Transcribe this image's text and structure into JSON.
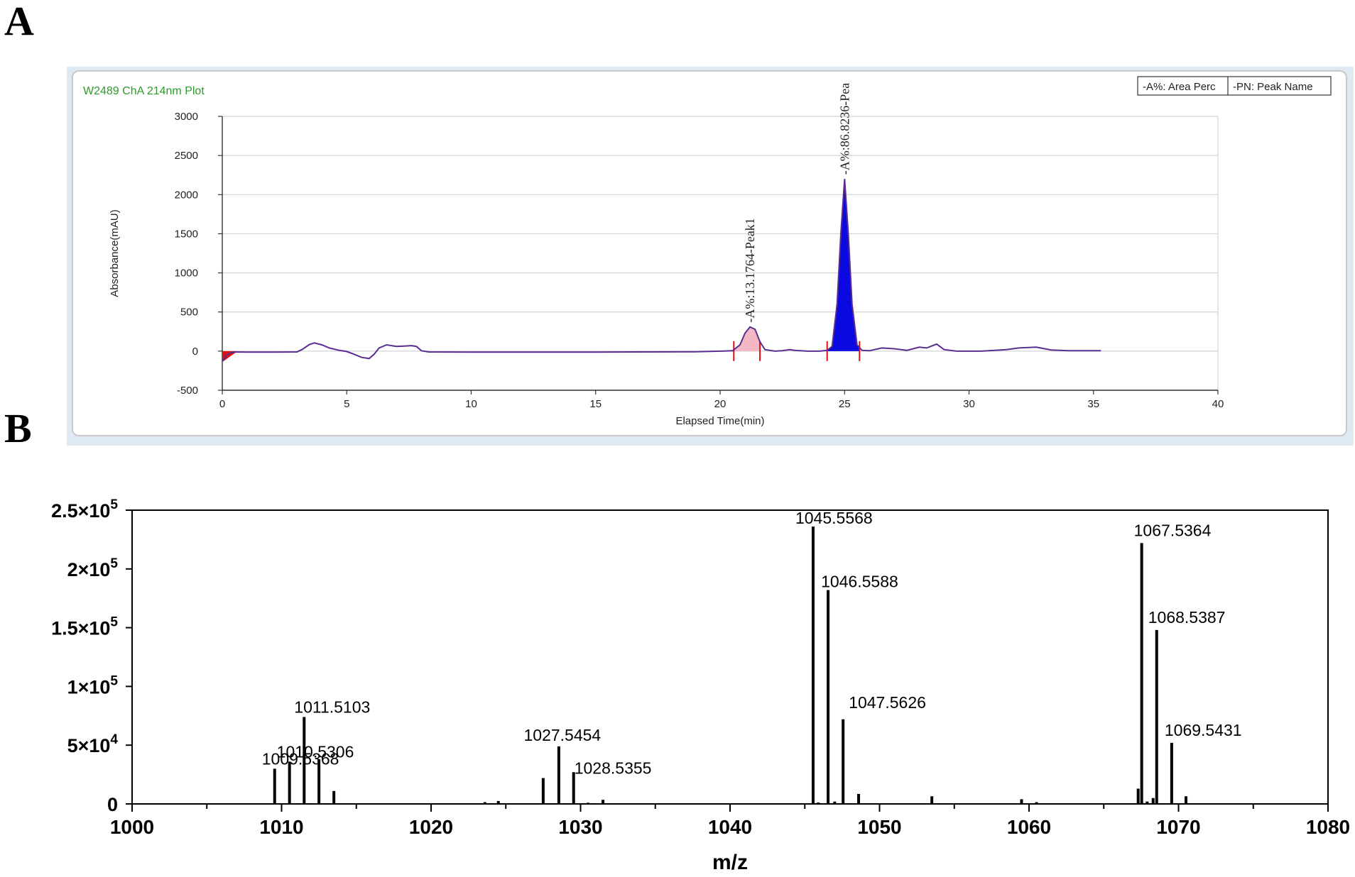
{
  "panels": {
    "a_letter": "A",
    "b_letter": "B"
  },
  "chart_data": [
    {
      "type": "line",
      "panel": "A",
      "title": "W2489 ChA 214nm Plot",
      "xlabel": "Elapsed Time(min)",
      "ylabel": "Absorbance(mAU)",
      "xlim": [
        0,
        40
      ],
      "ylim": [
        -500,
        3000
      ],
      "xticks": [
        0,
        5,
        10,
        15,
        20,
        25,
        30,
        35,
        40
      ],
      "yticks": [
        -500,
        0,
        500,
        1000,
        1500,
        2000,
        2500,
        3000
      ],
      "grid": true,
      "legend": {
        "position": "top-right",
        "entries": [
          "-A%: Area Perc",
          "-PN: Peak Name"
        ]
      },
      "trace": [
        [
          0.0,
          -130
        ],
        [
          0.15,
          -60
        ],
        [
          0.3,
          -25
        ],
        [
          0.5,
          -10
        ],
        [
          1.0,
          -12
        ],
        [
          2.0,
          -12
        ],
        [
          3.0,
          -10
        ],
        [
          3.2,
          20
        ],
        [
          3.5,
          85
        ],
        [
          3.7,
          105
        ],
        [
          4.0,
          80
        ],
        [
          4.3,
          40
        ],
        [
          4.7,
          10
        ],
        [
          5.0,
          -5
        ],
        [
          5.3,
          -40
        ],
        [
          5.6,
          -80
        ],
        [
          5.9,
          -95
        ],
        [
          6.1,
          -40
        ],
        [
          6.3,
          40
        ],
        [
          6.6,
          80
        ],
        [
          7.0,
          60
        ],
        [
          7.3,
          65
        ],
        [
          7.6,
          70
        ],
        [
          7.8,
          60
        ],
        [
          8.0,
          5
        ],
        [
          8.3,
          -10
        ],
        [
          10,
          -12
        ],
        [
          15,
          -12
        ],
        [
          19.0,
          -8
        ],
        [
          20.0,
          0
        ],
        [
          20.5,
          5
        ],
        [
          20.8,
          80
        ],
        [
          21.0,
          230
        ],
        [
          21.2,
          310
        ],
        [
          21.4,
          280
        ],
        [
          21.6,
          120
        ],
        [
          21.8,
          20
        ],
        [
          22.2,
          0
        ],
        [
          22.5,
          5
        ],
        [
          22.8,
          20
        ],
        [
          23.0,
          10
        ],
        [
          23.5,
          0
        ],
        [
          24.0,
          0
        ],
        [
          24.3,
          10
        ],
        [
          24.5,
          60
        ],
        [
          24.7,
          600
        ],
        [
          24.85,
          1500
        ],
        [
          25.0,
          2200
        ],
        [
          25.15,
          1500
        ],
        [
          25.3,
          600
        ],
        [
          25.5,
          80
        ],
        [
          25.7,
          10
        ],
        [
          26.0,
          5
        ],
        [
          26.5,
          40
        ],
        [
          27.0,
          30
        ],
        [
          27.5,
          10
        ],
        [
          28.0,
          50
        ],
        [
          28.3,
          40
        ],
        [
          28.7,
          90
        ],
        [
          29.0,
          20
        ],
        [
          29.5,
          0
        ],
        [
          30.5,
          0
        ],
        [
          31.5,
          20
        ],
        [
          32.0,
          40
        ],
        [
          32.7,
          50
        ],
        [
          33.3,
          15
        ],
        [
          34.0,
          5
        ],
        [
          35.3,
          5
        ]
      ],
      "peaks": [
        {
          "label": "-A%:13.1764-Peak1",
          "apex": [
            21.2,
            310
          ],
          "start": 20.55,
          "end": 21.6,
          "fill": "#f4b8c4"
        },
        {
          "label": "-A%:86.8236-Pea",
          "apex": [
            25.0,
            2200
          ],
          "start": 24.3,
          "end": 25.6,
          "fill": "#0a0ae0"
        }
      ],
      "line_color": "#5a2d91"
    },
    {
      "type": "bar",
      "panel": "B",
      "xlabel": "m/z",
      "ylabel": "",
      "xlim": [
        1000,
        1080
      ],
      "ylim": [
        0,
        250000
      ],
      "xticks": [
        1000,
        1010,
        1020,
        1030,
        1040,
        1050,
        1060,
        1070,
        1080
      ],
      "yticks": [
        {
          "value": 0,
          "mant": "0",
          "exp": ""
        },
        {
          "value": 50000,
          "mant": "5×10",
          "exp": "4"
        },
        {
          "value": 100000,
          "mant": "1×10",
          "exp": "5"
        },
        {
          "value": 150000,
          "mant": "1.5×10",
          "exp": "5"
        },
        {
          "value": 200000,
          "mant": "2×10",
          "exp": "5"
        },
        {
          "value": 250000,
          "mant": "2.5×10",
          "exp": "5"
        }
      ],
      "peaks": [
        {
          "mz": 1009.5368,
          "intensity": 30000,
          "label": "1009.5368"
        },
        {
          "mz": 1010.5306,
          "intensity": 36000,
          "label": "1010.5306"
        },
        {
          "mz": 1011.5103,
          "intensity": 74000,
          "label": "1011.5103"
        },
        {
          "mz": 1012.5,
          "intensity": 38000,
          "label": ""
        },
        {
          "mz": 1013.5,
          "intensity": 11000,
          "label": ""
        },
        {
          "mz": 1023.6,
          "intensity": 1500,
          "label": ""
        },
        {
          "mz": 1024.5,
          "intensity": 2500,
          "label": ""
        },
        {
          "mz": 1027.5,
          "intensity": 22000,
          "label": ""
        },
        {
          "mz": 1028.5454,
          "intensity": 49000,
          "label": "1027.5454"
        },
        {
          "mz": 1029.5355,
          "intensity": 27000,
          "label": "1028.5355"
        },
        {
          "mz": 1030.5,
          "intensity": 1000,
          "label": ""
        },
        {
          "mz": 1031.5,
          "intensity": 3500,
          "label": ""
        },
        {
          "mz": 1045.5568,
          "intensity": 236000,
          "label": "1045.5568"
        },
        {
          "mz": 1045.9,
          "intensity": 1200,
          "label": ""
        },
        {
          "mz": 1046.5588,
          "intensity": 182000,
          "label": "1046.5588"
        },
        {
          "mz": 1047.0,
          "intensity": 2000,
          "label": ""
        },
        {
          "mz": 1047.5626,
          "intensity": 72000,
          "label": "1047.5626"
        },
        {
          "mz": 1048.6,
          "intensity": 8500,
          "label": ""
        },
        {
          "mz": 1053.5,
          "intensity": 6500,
          "label": ""
        },
        {
          "mz": 1059.5,
          "intensity": 4000,
          "label": ""
        },
        {
          "mz": 1060.5,
          "intensity": 1500,
          "label": ""
        },
        {
          "mz": 1067.3,
          "intensity": 13000,
          "label": ""
        },
        {
          "mz": 1067.5364,
          "intensity": 222000,
          "label": "1067.5364"
        },
        {
          "mz": 1067.9,
          "intensity": 2000,
          "label": ""
        },
        {
          "mz": 1068.5387,
          "intensity": 148000,
          "label": "1068.5387"
        },
        {
          "mz": 1068.3,
          "intensity": 5000,
          "label": ""
        },
        {
          "mz": 1069.5431,
          "intensity": 52000,
          "label": "1069.5431"
        },
        {
          "mz": 1070.5,
          "intensity": 6500,
          "label": ""
        }
      ]
    }
  ]
}
